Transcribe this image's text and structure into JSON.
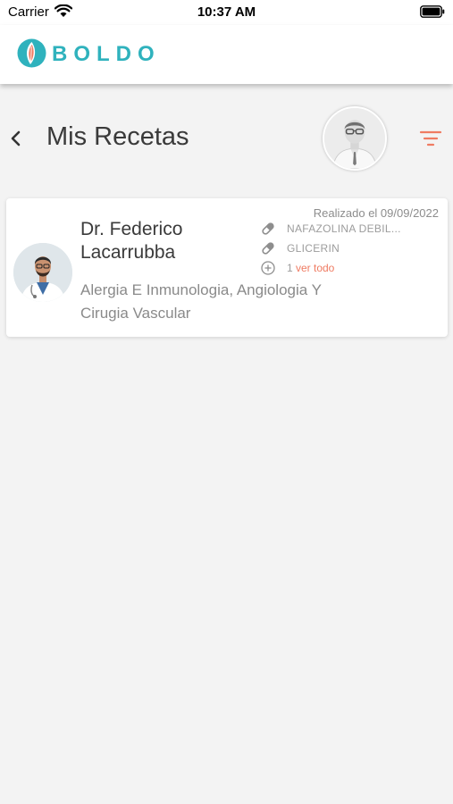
{
  "status_bar": {
    "carrier": "Carrier",
    "time": "10:37 AM"
  },
  "app": {
    "logo_text": "BOLDO",
    "brand_color": "#2fb2bd",
    "accent_color": "#ef7b62"
  },
  "page": {
    "title": "Mis Recetas"
  },
  "prescriptions": [
    {
      "doctor_name": "Dr. Federico Lacarrubba",
      "specialty": "Alergia E Inmunologia, Angiologia Y Cirugia Vascular",
      "date_label": "Realizado el 09/09/2022",
      "medications": [
        "NAFAZOLINA DEBIL...",
        "GLICERIN"
      ],
      "more_count": "1",
      "see_all_label": "ver todo"
    }
  ]
}
